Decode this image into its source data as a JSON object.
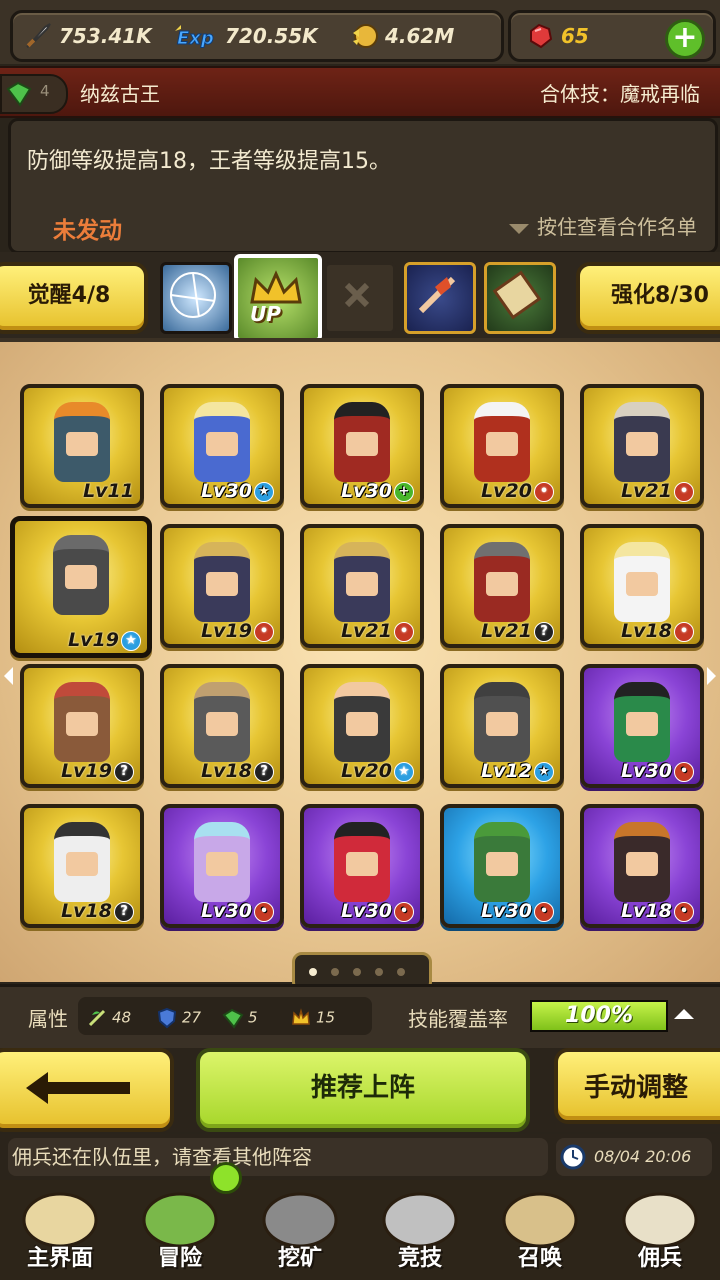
{
  "resources": {
    "attack": "753.41K",
    "exp": "720.55K",
    "gold": "4.62M",
    "gems": "65",
    "exp_icon_text": "Exp"
  },
  "combo": {
    "count": "4",
    "name": "纳兹古王",
    "skill": "合体技：魔戒再临",
    "description": "防御等级提高18，王者等级提高15。",
    "status": "未发动",
    "hint": "按住查看合作名单"
  },
  "awaken": {
    "awaken_label": "觉醒4/8",
    "enhance_label": "强化8/30",
    "up_label": "UP"
  },
  "heroes": [
    {
      "lv": "Lv11",
      "badge": "",
      "frame": "gold",
      "cloak": "#3d5a6a",
      "hair": "#e88a2a"
    },
    {
      "lv": "Lv30",
      "badge": "star",
      "frame": "gold",
      "cloak": "#4a6ad0",
      "hair": "#f4e6a0"
    },
    {
      "lv": "Lv30",
      "badge": "plus",
      "frame": "gold",
      "cloak": "#a02a22",
      "hair": "#222222"
    },
    {
      "lv": "Lv20",
      "badge": "red",
      "frame": "gold",
      "cloak": "#b0301e",
      "hair": "#f4f4f4"
    },
    {
      "lv": "Lv21",
      "badge": "red",
      "frame": "gold",
      "cloak": "#3a3a50",
      "hair": "#d8d0c0"
    },
    {
      "lv": "Lv19",
      "badge": "star",
      "frame": "gold",
      "cloak": "#4a4a4a",
      "hair": "#6a6a6a"
    },
    {
      "lv": "Lv19",
      "badge": "red",
      "frame": "gold",
      "cloak": "#3a3a5a",
      "hair": "#d6b45a"
    },
    {
      "lv": "Lv21",
      "badge": "red",
      "frame": "gold",
      "cloak": "#3a3a5a",
      "hair": "#d6b45a"
    },
    {
      "lv": "Lv21",
      "badge": "q",
      "frame": "gold",
      "cloak": "#9a2a22",
      "hair": "#707070"
    },
    {
      "lv": "Lv18",
      "badge": "red",
      "frame": "gold",
      "cloak": "#f4f4f4",
      "hair": "#f4e6a0"
    },
    {
      "lv": "Lv19",
      "badge": "q",
      "frame": "gold",
      "cloak": "#8a5a3a",
      "hair": "#c04a3a"
    },
    {
      "lv": "Lv18",
      "badge": "q",
      "frame": "gold",
      "cloak": "#5a5a5a",
      "hair": "#c0a070"
    },
    {
      "lv": "Lv20",
      "badge": "star",
      "frame": "gold",
      "cloak": "#3a3a3a",
      "hair": "#f2c9a0"
    },
    {
      "lv": "Lv12",
      "badge": "star",
      "frame": "gold",
      "cloak": "#505050",
      "hair": "#404040"
    },
    {
      "lv": "Lv30",
      "badge": "red",
      "frame": "purple",
      "cloak": "#2a8a4a",
      "hair": "#222222"
    },
    {
      "lv": "Lv18",
      "badge": "q",
      "frame": "gold",
      "cloak": "#eeeeee",
      "hair": "#333333"
    },
    {
      "lv": "Lv30",
      "badge": "red",
      "frame": "purple",
      "cloak": "#c8a8e8",
      "hair": "#a8e0f0"
    },
    {
      "lv": "Lv30",
      "badge": "red",
      "frame": "purple",
      "cloak": "#d02a3a",
      "hair": "#222222"
    },
    {
      "lv": "Lv30",
      "badge": "red",
      "frame": "blue",
      "cloak": "#3a7a3a",
      "hair": "#4a9a3a"
    },
    {
      "lv": "Lv18",
      "badge": "red",
      "frame": "purple",
      "cloak": "#3a2a2a",
      "hair": "#c8762a"
    }
  ],
  "selected_index": 5,
  "pager": {
    "total": 5,
    "active": 0
  },
  "attributes": {
    "label": "属性",
    "nature": "48",
    "defense": "27",
    "gem": "5",
    "king": "15",
    "coverage_label": "技能覆盖率",
    "coverage": "100%",
    "coverage_fraction": 1.0
  },
  "actions": {
    "recommend": "推荐上阵",
    "manual": "手动调整"
  },
  "message": "佣兵还在队伍里，请查看其他阵容",
  "time": "08/04 20:06",
  "nav": [
    {
      "label": "主界面",
      "icon": "map-scroll-icon"
    },
    {
      "label": "冒险",
      "icon": "island-icon"
    },
    {
      "label": "挖矿",
      "icon": "pickaxe-icon"
    },
    {
      "label": "竞技",
      "icon": "crossed-swords-icon"
    },
    {
      "label": "召唤",
      "icon": "summon-scroll-icon"
    },
    {
      "label": "佣兵",
      "icon": "tent-icon"
    }
  ],
  "colors": {
    "gold": "#e7c634",
    "purple": "#8a44d6",
    "blue": "#2da2e6",
    "accent_green": "#a6d62a",
    "status_orange": "#ec7d3a"
  }
}
